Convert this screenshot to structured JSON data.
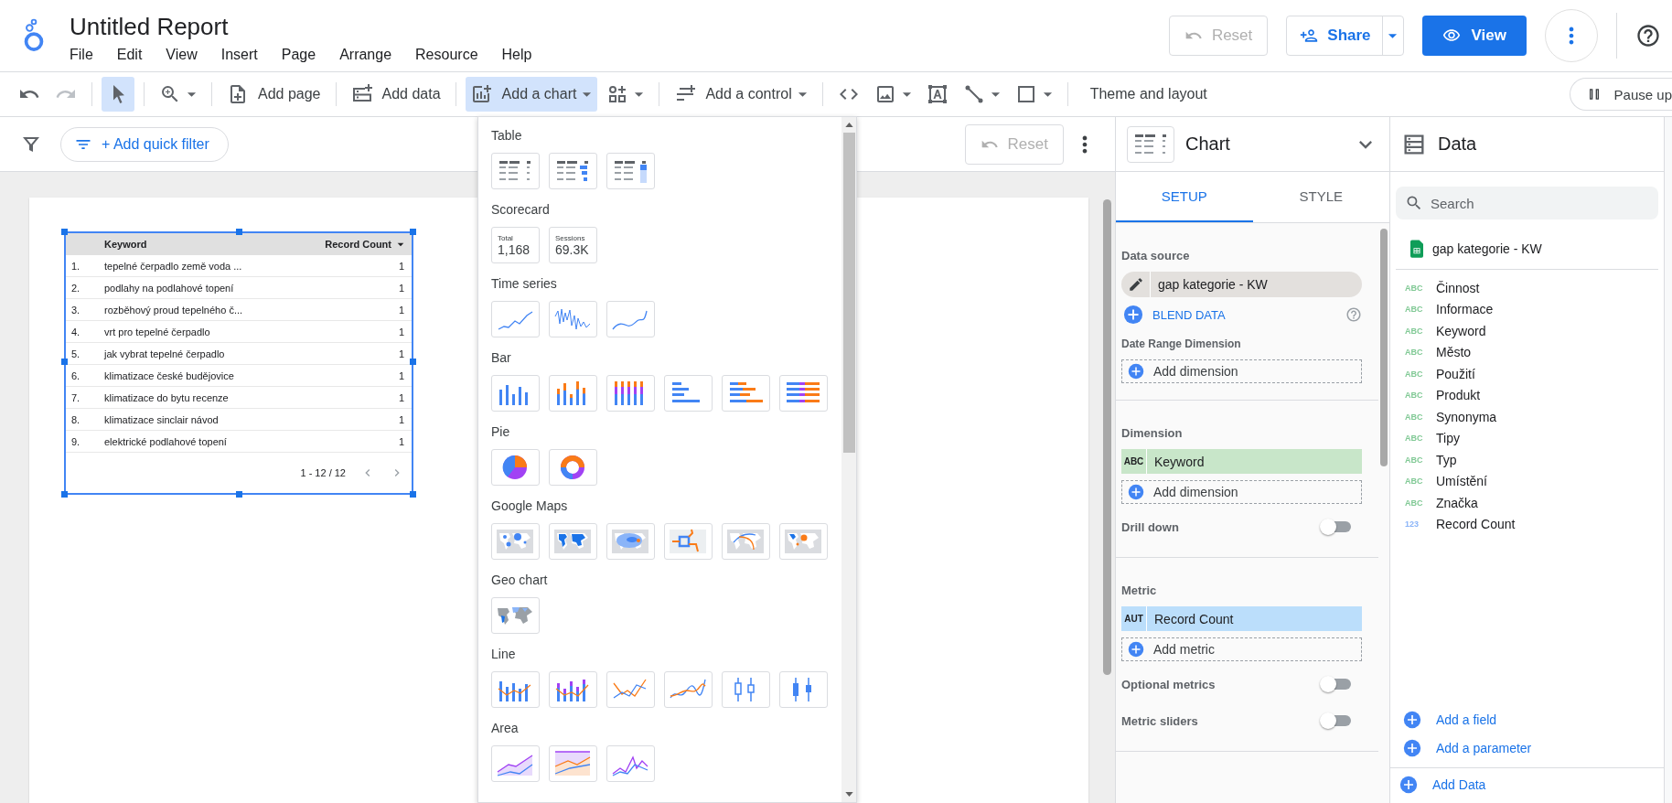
{
  "report": {
    "title": "Untitled Report",
    "menus": [
      "File",
      "Edit",
      "View",
      "Insert",
      "Page",
      "Arrange",
      "Resource",
      "Help"
    ]
  },
  "header_actions": {
    "reset": {
      "label": "Reset",
      "disabled": true
    },
    "share": {
      "label": "Share"
    },
    "view": {
      "label": "View"
    }
  },
  "toolbar": [
    {
      "kind": "undo",
      "selected": false,
      "disabled": false,
      "caret": false
    },
    {
      "kind": "redo",
      "selected": false,
      "disabled": true,
      "caret": false
    },
    {
      "kind": "divider"
    },
    {
      "kind": "select",
      "selected": true,
      "disabled": false,
      "caret": false
    },
    {
      "kind": "divider"
    },
    {
      "kind": "zoom",
      "selected": false,
      "disabled": false,
      "caret": true
    },
    {
      "kind": "divider"
    },
    {
      "kind": "add-page",
      "label": "Add page",
      "selected": false,
      "disabled": false,
      "caret": false
    },
    {
      "kind": "divider"
    },
    {
      "kind": "add-data",
      "label": "Add data",
      "selected": false,
      "disabled": false,
      "caret": false
    },
    {
      "kind": "divider"
    },
    {
      "kind": "add-chart",
      "label": "Add a chart",
      "selected": true,
      "disabled": false,
      "caret": true
    },
    {
      "kind": "components",
      "selected": false,
      "disabled": false,
      "caret": true
    },
    {
      "kind": "divider"
    },
    {
      "kind": "control",
      "label": "Add a control",
      "selected": false,
      "disabled": false,
      "caret": true
    },
    {
      "kind": "divider"
    },
    {
      "kind": "code",
      "selected": false,
      "disabled": false,
      "caret": false
    },
    {
      "kind": "image",
      "selected": false,
      "disabled": false,
      "caret": true
    },
    {
      "kind": "textbox",
      "selected": false,
      "disabled": false,
      "caret": false
    },
    {
      "kind": "line",
      "selected": false,
      "disabled": false,
      "caret": true
    },
    {
      "kind": "rectangle",
      "selected": false,
      "disabled": false,
      "caret": true
    },
    {
      "kind": "divider"
    },
    {
      "kind": "theme",
      "label": "Theme and layout",
      "selected": false,
      "disabled": false,
      "caret": false
    }
  ],
  "pause_button": {
    "label": "Pause up"
  },
  "filter_bar": {
    "add_filter": "+ Add quick filter",
    "reset": {
      "label": "Reset",
      "disabled": true
    }
  },
  "table": {
    "columns": [
      "Keyword",
      "Record Count"
    ],
    "rows": [
      {
        "index": "1.",
        "keyword": "tepelné čerpadlo země voda ...",
        "count": "1"
      },
      {
        "index": "2.",
        "keyword": "podlahy na podlahové topení",
        "count": "1"
      },
      {
        "index": "3.",
        "keyword": "rozběhový proud tepelného č...",
        "count": "1"
      },
      {
        "index": "4.",
        "keyword": "vrt pro tepelné čerpadlo",
        "count": "1"
      },
      {
        "index": "5.",
        "keyword": "jak vybrat tepelné čerpadlo",
        "count": "1"
      },
      {
        "index": "6.",
        "keyword": "klimatizace české budějovice",
        "count": "1"
      },
      {
        "index": "7.",
        "keyword": "klimatizace do bytu recenze",
        "count": "1"
      },
      {
        "index": "8.",
        "keyword": "klimatizace sinclair návod",
        "count": "1"
      },
      {
        "index": "9.",
        "keyword": "elektrické podlahové topení",
        "count": "1"
      }
    ],
    "pagination": "1 - 12 / 12"
  },
  "chart_menu": [
    {
      "title": "Table",
      "options": [
        {
          "kind": "table"
        },
        {
          "kind": "table-bars"
        },
        {
          "kind": "table-heatmap"
        }
      ]
    },
    {
      "title": "Scorecard",
      "options": [
        {
          "kind": "scorecard",
          "caption": "Total",
          "value": "1,168"
        },
        {
          "kind": "scorecard",
          "caption": "Sessions",
          "value": "69.3K"
        }
      ]
    },
    {
      "title": "Time series",
      "options": [
        {
          "kind": "timeseries"
        },
        {
          "kind": "sparkline"
        },
        {
          "kind": "smooth"
        }
      ]
    },
    {
      "title": "Bar",
      "options": [
        {
          "kind": "column"
        },
        {
          "kind": "column-stacked"
        },
        {
          "kind": "column-100"
        },
        {
          "kind": "bar"
        },
        {
          "kind": "bar-stacked"
        },
        {
          "kind": "bar-100"
        }
      ]
    },
    {
      "title": "Pie",
      "options": [
        {
          "kind": "pie"
        },
        {
          "kind": "donut"
        }
      ]
    },
    {
      "title": "Google Maps",
      "options": [
        {
          "kind": "map-bubble"
        },
        {
          "kind": "map-filled"
        },
        {
          "kind": "map-heat"
        },
        {
          "kind": "map-line"
        },
        {
          "kind": "map-route"
        },
        {
          "kind": "map-combo"
        }
      ]
    },
    {
      "title": "Geo chart",
      "options": [
        {
          "kind": "geo"
        }
      ]
    },
    {
      "title": "Line",
      "options": [
        {
          "kind": "combo"
        },
        {
          "kind": "combo-stacked"
        },
        {
          "kind": "line"
        },
        {
          "kind": "line-smooth"
        },
        {
          "kind": "candlestick"
        },
        {
          "kind": "candlestick-filled"
        }
      ]
    },
    {
      "title": "Area",
      "options": [
        {
          "kind": "area"
        },
        {
          "kind": "area-stacked"
        },
        {
          "kind": "area-100"
        }
      ]
    }
  ],
  "chart_panel": {
    "title": "Chart",
    "tabs": [
      {
        "label": "SETUP",
        "selected": true
      },
      {
        "label": "STYLE",
        "selected": false
      }
    ],
    "data_source": {
      "heading": "Data source",
      "source": "gap kategorie - KW",
      "blend": "BLEND DATA",
      "date_range_heading": "Date Range Dimension",
      "date_range_add": "Add dimension"
    },
    "sections": [
      {
        "heading": "Dimension",
        "fields": [
          {
            "type": "ABC",
            "kind": "dimension",
            "name": "Keyword"
          }
        ],
        "add": "Add dimension",
        "toggles": [
          {
            "label": "Drill down",
            "on": false
          }
        ]
      },
      {
        "heading": "Metric",
        "fields": [
          {
            "type": "AUT",
            "kind": "metric",
            "name": "Record Count"
          }
        ],
        "add": "Add metric",
        "toggles": [
          {
            "label": "Optional metrics",
            "on": false
          },
          {
            "label": "Metric sliders",
            "on": false
          }
        ]
      }
    ]
  },
  "data_panel": {
    "title": "Data",
    "search_placeholder": "Search",
    "source": "gap kategorie - KW",
    "fields": [
      {
        "type": "ABC",
        "kind": "dimension",
        "name": "Činnost"
      },
      {
        "type": "ABC",
        "kind": "dimension",
        "name": "Informace"
      },
      {
        "type": "ABC",
        "kind": "dimension",
        "name": "Keyword"
      },
      {
        "type": "ABC",
        "kind": "dimension",
        "name": "Město"
      },
      {
        "type": "ABC",
        "kind": "dimension",
        "name": "Použití"
      },
      {
        "type": "ABC",
        "kind": "dimension",
        "name": "Produkt"
      },
      {
        "type": "ABC",
        "kind": "dimension",
        "name": "Synonyma"
      },
      {
        "type": "ABC",
        "kind": "dimension",
        "name": "Tipy"
      },
      {
        "type": "ABC",
        "kind": "dimension",
        "name": "Typ"
      },
      {
        "type": "ABC",
        "kind": "dimension",
        "name": "Umístění"
      },
      {
        "type": "ABC",
        "kind": "dimension",
        "name": "Značka"
      },
      {
        "type": "123",
        "kind": "metric",
        "name": "Record Count"
      }
    ],
    "actions": [
      "Add a field",
      "Add a parameter"
    ],
    "add_data": "Add Data"
  }
}
